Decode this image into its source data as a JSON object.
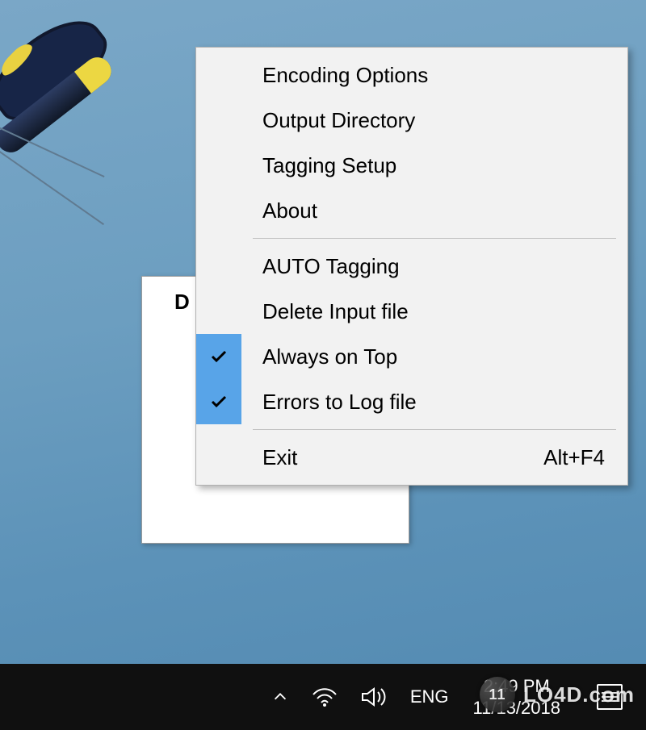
{
  "app_window": {
    "title_fragment": "D"
  },
  "context_menu": {
    "items": [
      {
        "label": "Encoding Options",
        "checked": false
      },
      {
        "label": "Output Directory",
        "checked": false
      },
      {
        "label": "Tagging Setup",
        "checked": false
      },
      {
        "label": "About",
        "checked": false
      }
    ],
    "toggle_items": [
      {
        "label": "AUTO Tagging",
        "checked": false
      },
      {
        "label": "Delete Input file",
        "checked": false
      },
      {
        "label": "Always on Top",
        "checked": true
      },
      {
        "label": "Errors to Log file",
        "checked": true
      }
    ],
    "exit": {
      "label": "Exit",
      "shortcut": "Alt+F4"
    }
  },
  "taskbar": {
    "lang": "ENG",
    "time": "2:49 PM",
    "date": "11/13/2018"
  },
  "watermark": {
    "globe_label": "11",
    "site": "LO4D.com"
  }
}
